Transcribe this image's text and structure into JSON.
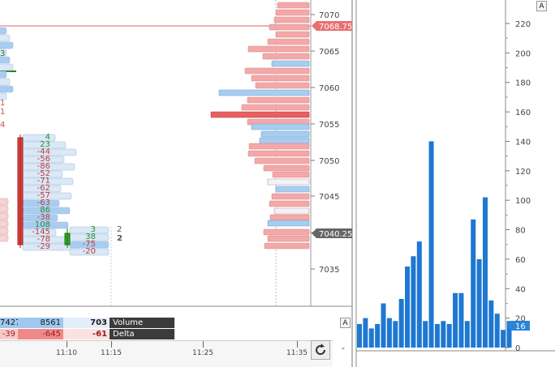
{
  "left_chart": {
    "price_ticks": [
      "7070",
      "7065",
      "7060",
      "7055",
      "7050",
      "7045",
      "7040",
      "7035"
    ],
    "current_price": "7068.75",
    "last_price": "7040.25",
    "delta_labels_col1": [
      "4",
      "23",
      "-44",
      "-56",
      "-86",
      "-52",
      "-71",
      "-62",
      "-57",
      "-63",
      "86",
      "-38",
      "108",
      "-145",
      "-78",
      "-29"
    ],
    "delta_labels_col2": [
      "3",
      "38",
      "-75",
      "-20"
    ],
    "trade_counts": [
      "2",
      "2"
    ],
    "stray_labels": [
      "3",
      "1",
      "1",
      "4"
    ],
    "button_a": "A",
    "colors": {
      "up": "#a8cdf0",
      "down": "#f4a8a8",
      "candle_red": "#e04040",
      "candle_green": "#33aa22",
      "price_line": "#e06060"
    }
  },
  "summary_table": {
    "rows": [
      {
        "name": "Volume",
        "cells": [
          "7427",
          "8561",
          "703"
        ]
      },
      {
        "name": "Delta",
        "cells": [
          "-39",
          "-645",
          "-61"
        ]
      }
    ],
    "button_a": "A"
  },
  "time_axis": {
    "labels": [
      "11:10",
      "11:15",
      "11:25",
      "11:35"
    ],
    "refresh_icon": "refresh-icon",
    "minus_label": "-"
  },
  "right_chart": {
    "y_ticks": [
      "220",
      "200",
      "180",
      "160",
      "140",
      "120",
      "100",
      "80",
      "60",
      "40",
      "20",
      "0"
    ],
    "current_value": "16",
    "button_a": "A",
    "chart_data": {
      "type": "bar",
      "values": [
        16,
        20,
        13,
        16,
        30,
        20,
        18,
        33,
        55,
        62,
        72,
        18,
        140,
        16,
        18,
        16,
        37,
        37,
        18,
        87,
        60,
        102,
        32,
        23,
        12,
        18
      ],
      "ylim": [
        0,
        230
      ]
    }
  }
}
